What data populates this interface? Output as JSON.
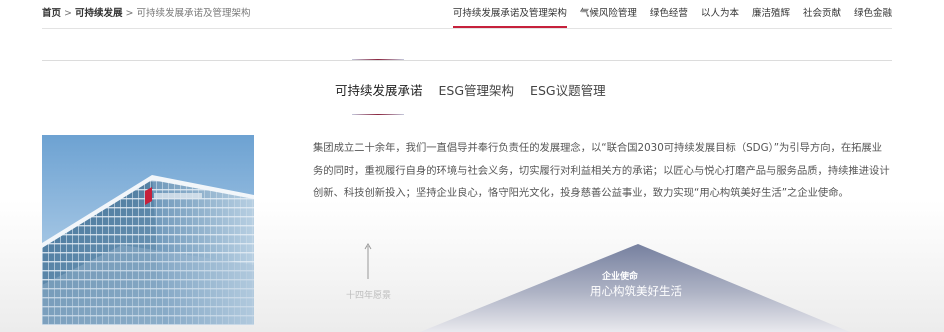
{
  "breadcrumb": {
    "home": "首页",
    "section": "可持续发展",
    "current": "可持续发展承诺及管理架构",
    "separator": ">"
  },
  "topnav": {
    "items": [
      {
        "label": "可持续发展承诺及管理架构",
        "active": true
      },
      {
        "label": "气候风险管理",
        "active": false
      },
      {
        "label": "绿色经营",
        "active": false
      },
      {
        "label": "以人为本",
        "active": false
      },
      {
        "label": "廉洁殖辉",
        "active": false
      },
      {
        "label": "社会贡献",
        "active": false
      },
      {
        "label": "绿色金融",
        "active": false
      }
    ]
  },
  "subtabs": {
    "items": [
      {
        "label": "可持续发展承诺",
        "active": true
      },
      {
        "label": "ESG管理架构",
        "active": false
      },
      {
        "label": "ESG议题管理",
        "active": false
      }
    ]
  },
  "intro": {
    "text": "集团成立二十余年，我们一直倡导并奉行负责任的发展理念，以“联合国2030可持续发展目标（SDG）”为引导方向，在拓展业务的同时，重视履行自身的环境与社会义务，切实履行对利益相关方的承诺；以匠心与悦心打磨产品与服务品质，持续推进设计创新、科技创新投入；坚持企业良心，恪守阳光文化，投身慈善公益事业，致力实现“用心构筑美好生活”之企业使命。"
  },
  "pyramid": {
    "mission_label": "企业使命",
    "mission_text": "用心构筑美好生活",
    "arrow_label": "十四年愿景"
  },
  "colors": {
    "accent": "#c6213b",
    "pyramid_fill": "#7a84a6"
  }
}
